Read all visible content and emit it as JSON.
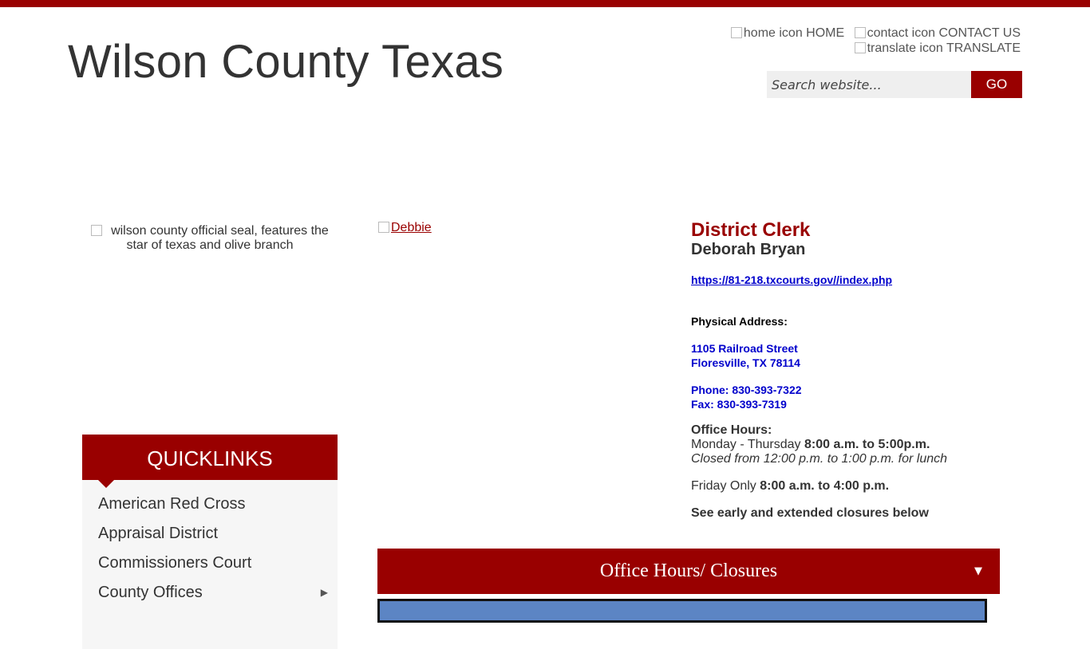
{
  "site": {
    "title": "Wilson County Texas"
  },
  "utility": {
    "home_alt": "home icon",
    "home_label": "HOME",
    "contact_alt": "contact icon",
    "contact_label": "CONTACT US",
    "translate_alt": "translate icon",
    "translate_label": "TRANSLATE"
  },
  "search": {
    "placeholder": "Search website...",
    "go_label": "GO"
  },
  "seal": {
    "alt": "wilson county official seal, features the star of texas and olive branch"
  },
  "photo": {
    "alt": "Debbie"
  },
  "clerk": {
    "title": "District Clerk",
    "name": "Deborah Bryan",
    "url": "https://81-218.txcourts.gov//index.php",
    "address_label": "Physical Address:",
    "address_line1": "1105 Railroad Street",
    "address_line2": "Floresville, TX 78114",
    "phone": "Phone: 830-393-7322",
    "fax": "Fax: 830-393-7319",
    "hours_label": "Office Hours:",
    "mon_thu_prefix": "Monday - Thursday ",
    "mon_thu_hours": "8:00 a.m. to 5:00p.m.",
    "lunch_note": "Closed from 12:00 p.m. to 1:00 p.m. for lunch",
    "fri_prefix": "Friday Only ",
    "fri_hours": "8:00 a.m. to 4:00 p.m.",
    "closures_note": "See early and extended closures below"
  },
  "quicklinks": {
    "title": "QUICKLINKS",
    "items": [
      {
        "label": "American Red Cross"
      },
      {
        "label": "Appraisal District"
      },
      {
        "label": "Commissioners Court"
      },
      {
        "label": "County Offices",
        "has_submenu": true
      }
    ]
  },
  "accordion": {
    "title": "Office Hours/ Closures",
    "arrow": "▼"
  },
  "colors": {
    "brand": "#990000",
    "link_blue": "#0000cc",
    "panel_blue": "#5c85c4"
  }
}
